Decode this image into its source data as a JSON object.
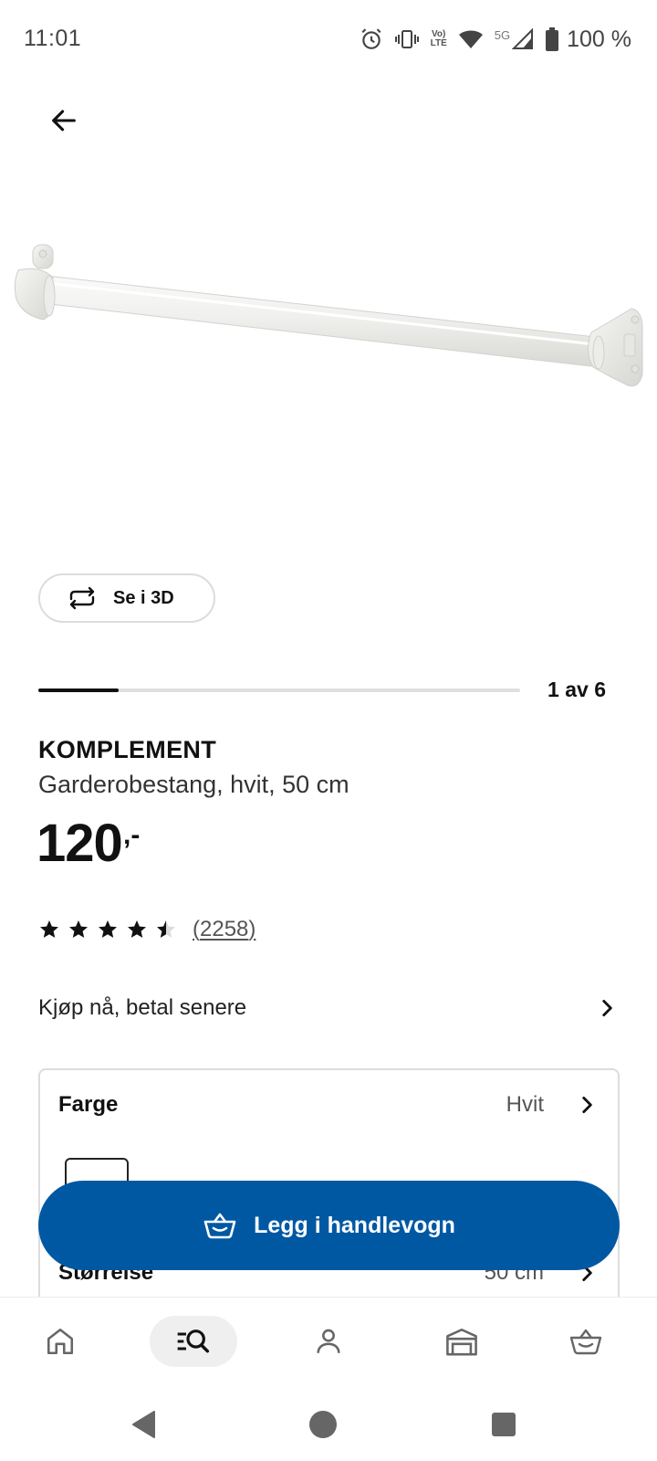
{
  "status_bar": {
    "time": "11:01",
    "network": "5G",
    "battery": "100 %"
  },
  "product": {
    "brand": "KOMPLEMENT",
    "description": "Garderobestang, hvit, 50 cm",
    "price": "120",
    "price_suffix": ",-",
    "view_3d_label": "Se i 3D",
    "image_index_text": "1 av 6",
    "image_progress": 0.1667,
    "rating_value": 4.5,
    "rating_max": 5,
    "review_count": "2258"
  },
  "bnpl": {
    "label": "Kjøp nå, betal senere"
  },
  "options": {
    "color_label": "Farge",
    "color_value": "Hvit",
    "size_label": "Størrelse",
    "size_value": "50 cm"
  },
  "cta": {
    "add_to_cart_label": "Legg i handlevogn"
  },
  "bottom_nav": {
    "items": [
      "home-icon",
      "search-icon",
      "profile-icon",
      "store-icon",
      "cart-icon"
    ],
    "active": "search-icon"
  },
  "colors": {
    "primary": "#0058a3",
    "text": "#111111"
  }
}
